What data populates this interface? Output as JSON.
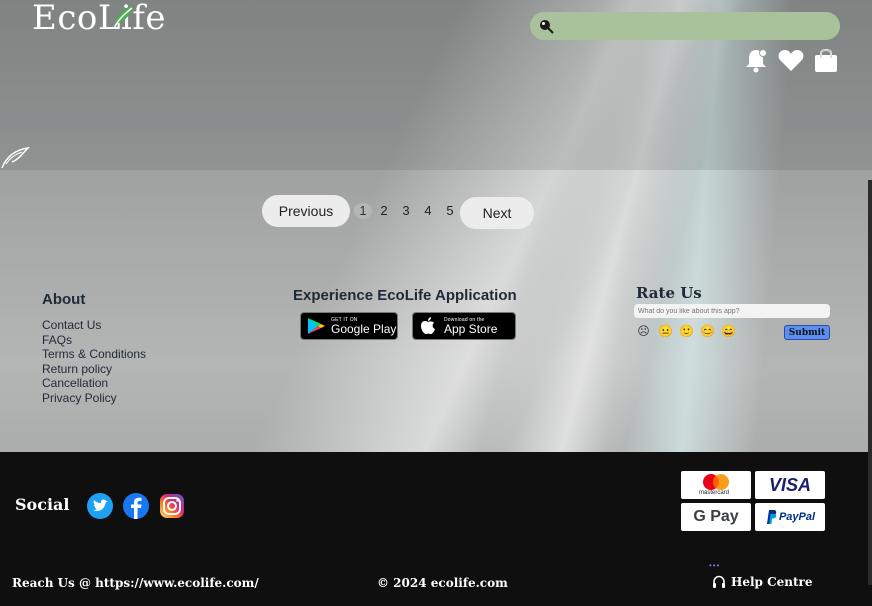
{
  "header": {
    "logo_text": "EcoLife",
    "search": {
      "placeholder": ""
    },
    "icons": [
      "notification-bell-icon",
      "heart-icon",
      "shopping-bag-icon"
    ]
  },
  "pagination": {
    "previous_label": "Previous",
    "next_label": "Next",
    "pages": [
      "1",
      "2",
      "3",
      "4",
      "5"
    ],
    "current_page": "1"
  },
  "about": {
    "title": "About",
    "links": [
      "Contact Us",
      "FAQs",
      "Terms & Conditions",
      "Return policy",
      "Cancellation",
      "Privacy Policy"
    ]
  },
  "app": {
    "title": "Experience EcoLife Application",
    "google_play": {
      "small": "GET IT ON",
      "big": "Google Play"
    },
    "app_store": {
      "small": "Download on the",
      "big": "App Store"
    }
  },
  "rate": {
    "title": "Rate Us",
    "input_placeholder": "What do you like about this app?",
    "faces": [
      "☹",
      "😐",
      "🙂",
      "😊",
      "😄"
    ],
    "submit_label": "Submit"
  },
  "footer": {
    "social_label": "Social",
    "social_icons": [
      "twitter-icon",
      "facebook-icon",
      "instagram-icon"
    ],
    "payments": [
      "mastercard",
      "VISA",
      "G Pay",
      "PayPal"
    ],
    "mastercard_text": "mastercard",
    "visa_text": "VISA",
    "gpay_text": "G Pay",
    "paypal_text": "PayPal",
    "reach_text": "Reach Us @ https://www.ecolife.com/",
    "copyright": "© 2024 ecolife.com",
    "help_label": "Help Centre"
  },
  "colors": {
    "search_bg": "#a9c29b",
    "footer_bg": "#0f0f0f",
    "submit_bg": "#5b8ef0",
    "logo_leaf": "#4caf50"
  }
}
